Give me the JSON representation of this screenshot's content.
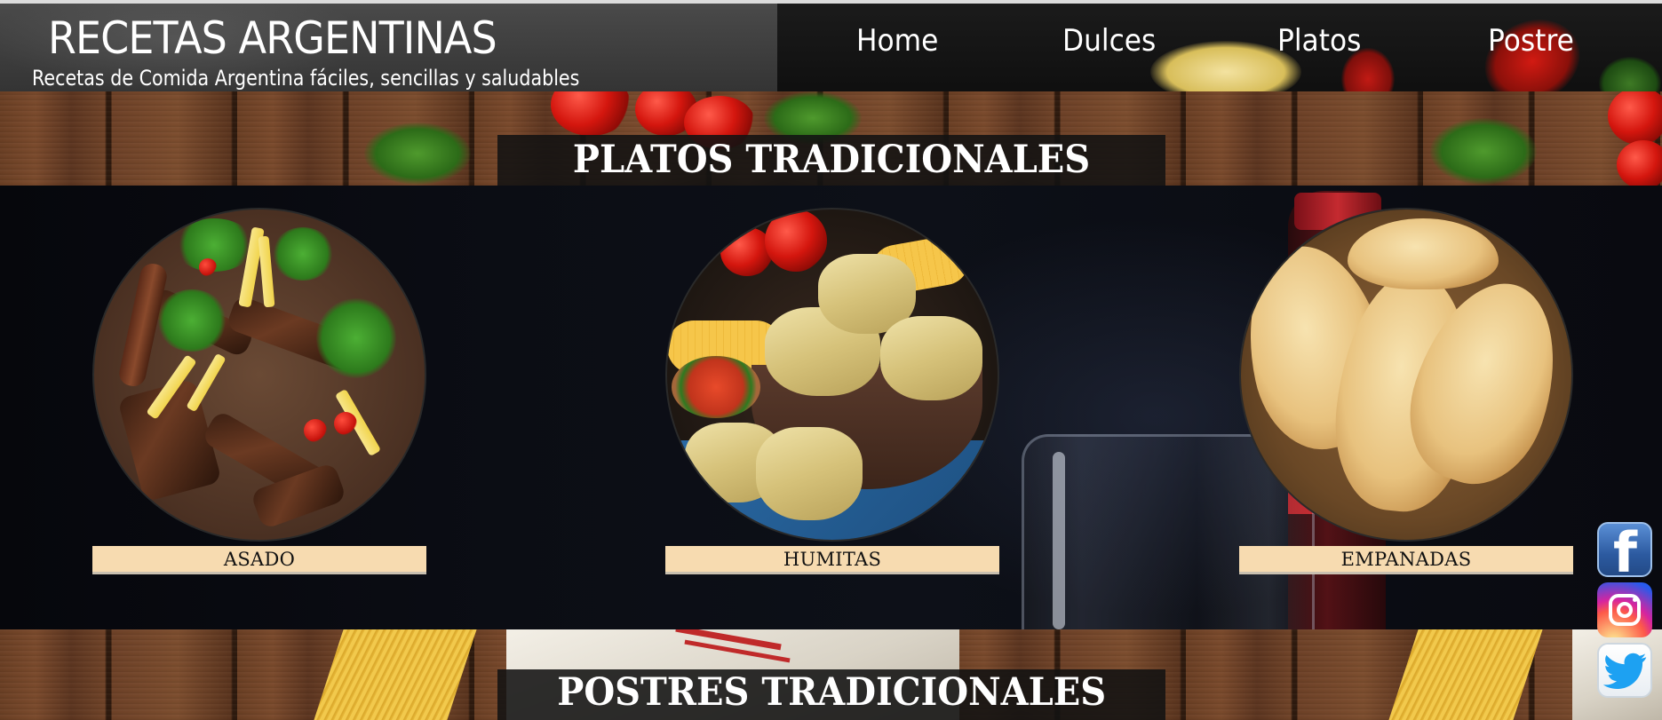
{
  "header": {
    "title": "RECETAS ARGENTINAS",
    "subtitle": "Recetas de Comida Argentina fáciles, sencillas y saludables"
  },
  "nav": {
    "items": [
      {
        "label": "Home"
      },
      {
        "label": "Dulces"
      },
      {
        "label": "Platos"
      },
      {
        "label": "Postre"
      }
    ]
  },
  "sections": {
    "platos_heading": "PLATOS TRADICIONALES",
    "postres_heading": "POSTRES TRADICIONALES"
  },
  "dishes": [
    {
      "label": "ASADO",
      "image": "asado-photo"
    },
    {
      "label": "HUMITAS",
      "image": "humitas-photo"
    },
    {
      "label": "EMPANADAS",
      "image": "empanadas-photo"
    }
  ],
  "social": [
    {
      "name": "facebook-icon"
    },
    {
      "name": "instagram-icon"
    },
    {
      "name": "twitter-icon"
    }
  ],
  "colors": {
    "label_bg": "#f7dbb0",
    "heading_bg": "#121212",
    "text_light": "#ffffff"
  }
}
